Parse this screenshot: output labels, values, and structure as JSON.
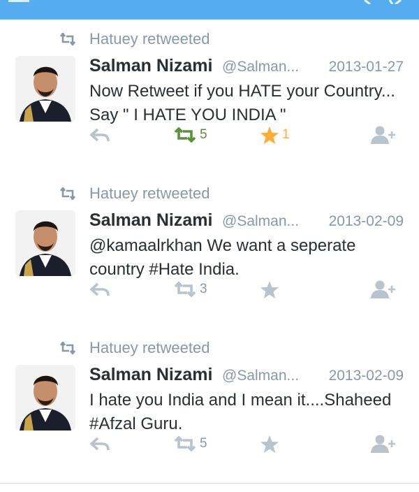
{
  "colors": {
    "header": "#55acee",
    "retweet_active": "#5c913b",
    "favorite_active": "#ffac33",
    "muted": "#8899a6",
    "text": "#292f33"
  },
  "tweets": [
    {
      "retweeted_by": "Hatuey retweeted",
      "name": "Salman Nizami",
      "handle": "@Salman...",
      "date": "2013-01-27",
      "text": "Now Retweet if you HATE your Country... Say \" I HATE YOU INDIA \"",
      "retweets": "5",
      "favorites": "1",
      "retweet_active": true,
      "favorite_active": true
    },
    {
      "retweeted_by": "Hatuey retweeted",
      "name": "Salman Nizami",
      "handle": "@Salman...",
      "date": "2013-02-09",
      "text": "@kamaalrkhan We want a seperate country #Hate India.",
      "retweets": "3",
      "favorites": "",
      "retweet_active": false,
      "favorite_active": false
    },
    {
      "retweeted_by": "Hatuey retweeted",
      "name": "Salman Nizami",
      "handle": "@Salman...",
      "date": "2013-02-09",
      "text": "I hate you India and I mean it....Shaheed #Afzal Guru.",
      "retweets": "5",
      "favorites": "",
      "retweet_active": false,
      "favorite_active": false
    }
  ],
  "icons": {
    "retweet": "retweet-icon",
    "reply": "reply-icon",
    "favorite": "star-icon",
    "follow": "follow-user-icon"
  }
}
